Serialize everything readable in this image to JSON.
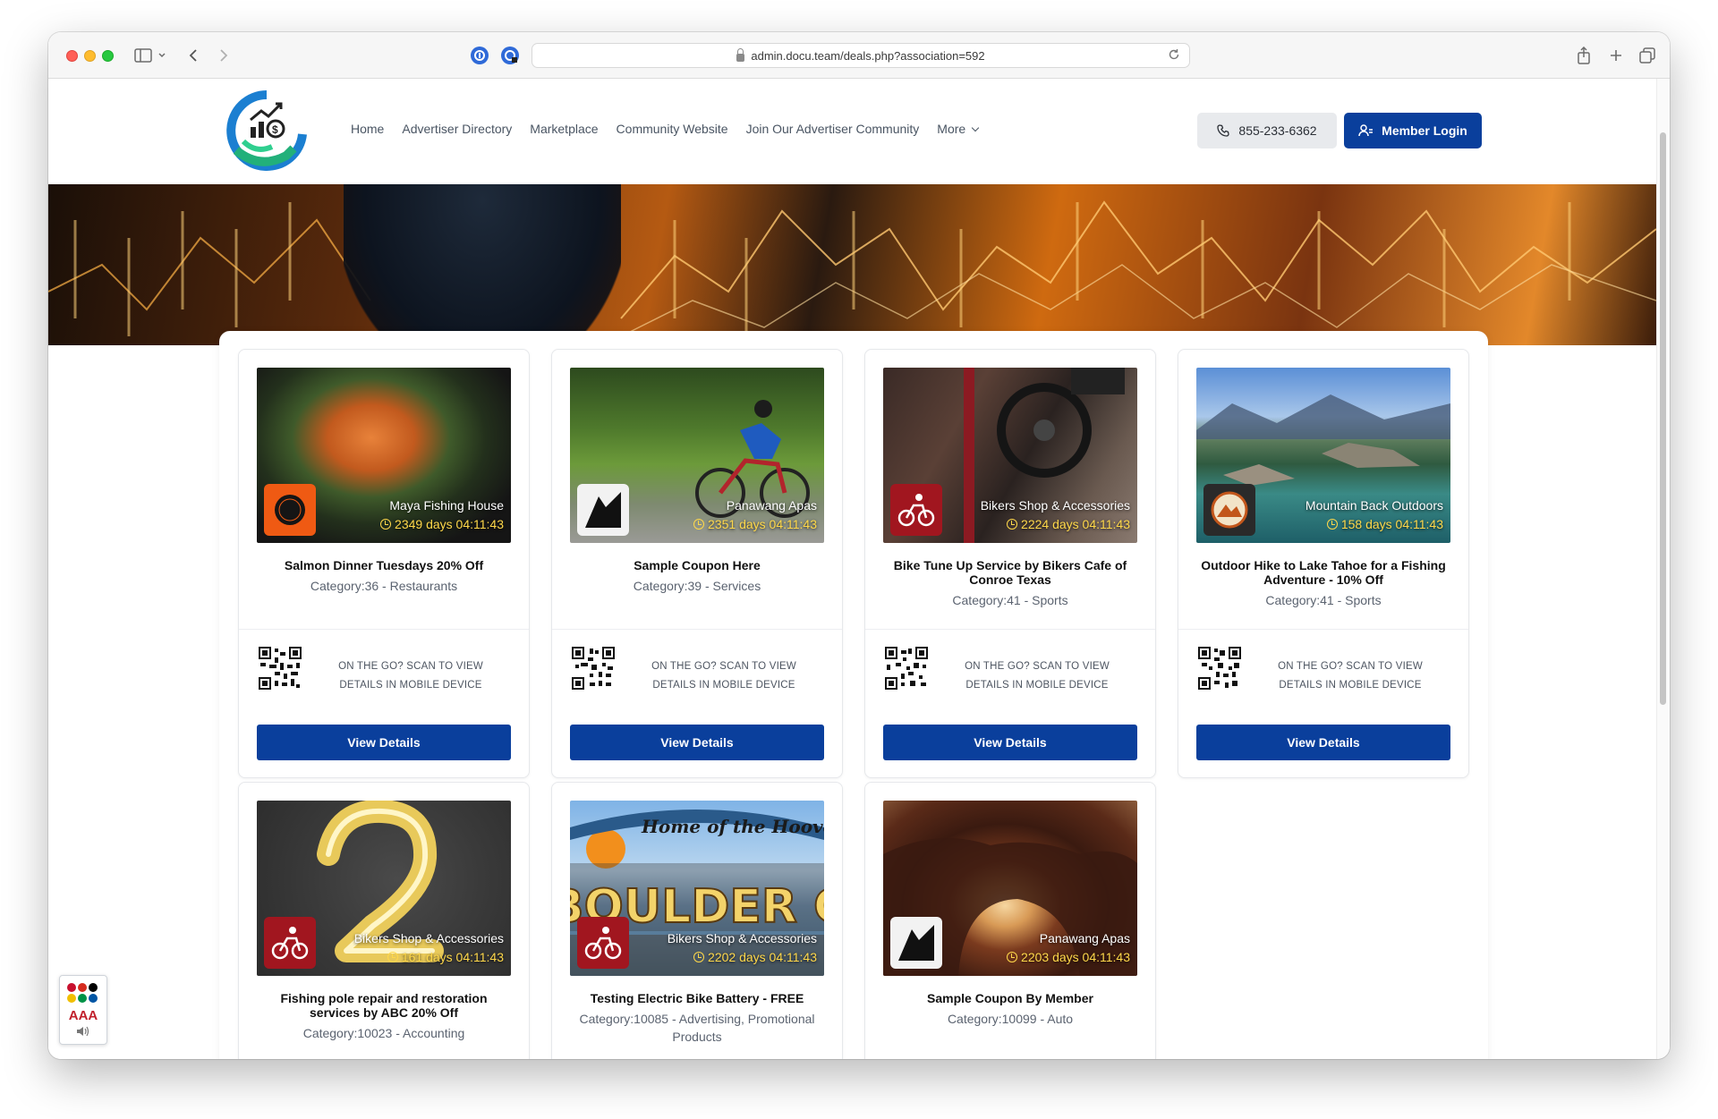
{
  "browser": {
    "url": "admin.docu.team/deals.php?association=592"
  },
  "header": {
    "nav": [
      "Home",
      "Advertiser Directory",
      "Marketplace",
      "Community Website",
      "Join Our Advertiser Community",
      "More"
    ],
    "phone": "855-233-6362",
    "login_label": "Member Login"
  },
  "deals": [
    {
      "shop": "Maya Fishing House",
      "timer": "2349 days 04:11:43",
      "title": "Salmon Dinner Tuesdays 20% Off",
      "category": "Category:36 - Restaurants",
      "scan": "ON THE GO? SCAN TO VIEW DETAILS IN MOBILE DEVICE",
      "button": "View Details"
    },
    {
      "shop": "Panawang Apas",
      "timer": "2351 days 04:11:43",
      "title": "Sample Coupon Here",
      "category": "Category:39 - Services",
      "scan": "ON THE GO? SCAN TO VIEW DETAILS IN MOBILE DEVICE",
      "button": "View Details"
    },
    {
      "shop": "Bikers Shop & Accessories",
      "timer": "2224 days 04:11:43",
      "title": "Bike Tune Up Service by Bikers Cafe of Conroe Texas",
      "category": "Category:41 - Sports",
      "scan": "ON THE GO? SCAN TO VIEW DETAILS IN MOBILE DEVICE",
      "button": "View Details"
    },
    {
      "shop": "Mountain Back Outdoors",
      "timer": "158 days 04:11:43",
      "title": "Outdoor Hike to Lake Tahoe for a Fishing Adventure - 10% Off",
      "category": "Category:41 - Sports",
      "scan": "ON THE GO? SCAN TO VIEW DETAILS IN MOBILE DEVICE",
      "button": "View Details"
    },
    {
      "shop": "Bikers Shop & Accessories",
      "timer": "161 days 04:11:43",
      "title": "Fishing pole repair and restoration services by ABC 20% Off",
      "category": "Category:10023 - Accounting"
    },
    {
      "shop": "Bikers Shop & Accessories",
      "timer": "2202 days 04:11:43",
      "title": "Testing Electric Bike Battery - FREE",
      "category": "Category:10085 - Advertising, Promotional Products"
    },
    {
      "shop": "Panawang Apas",
      "timer": "2203 days 04:11:43",
      "title": "Sample Coupon By Member",
      "category": "Category:10099 - Auto"
    }
  ],
  "banner_texts": {
    "dam_top": "Home of the Hoover Dam",
    "dam_big": "BOULDER CITY"
  },
  "accessibility_widget": {
    "text": "AAA"
  },
  "colors": {
    "primary": "#0a3f9c",
    "timer": "#ffd84a"
  }
}
